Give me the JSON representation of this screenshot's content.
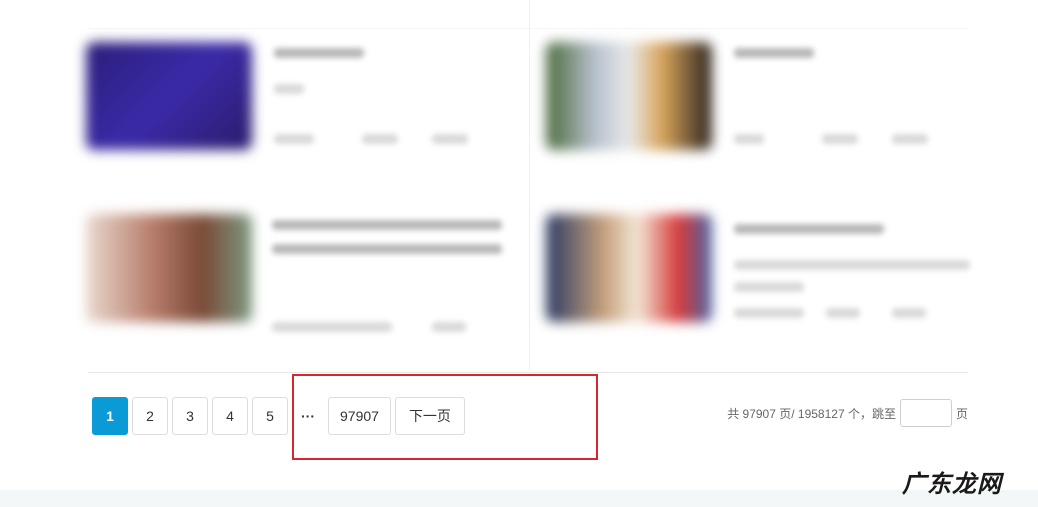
{
  "pagination": {
    "pages": [
      "1",
      "2",
      "3",
      "4",
      "5"
    ],
    "active_page": "1",
    "ellipsis": "···",
    "last_page": "97907",
    "next_label": "下一页"
  },
  "pager_info": {
    "summary": "共 97907 页/ 1958127 个，",
    "jump_label": "跳至",
    "page_unit": "页"
  },
  "watermark": {
    "text": "广东龙网"
  },
  "colors": {
    "accent": "#0a9bd6",
    "highlight_border": "#d9262e"
  }
}
